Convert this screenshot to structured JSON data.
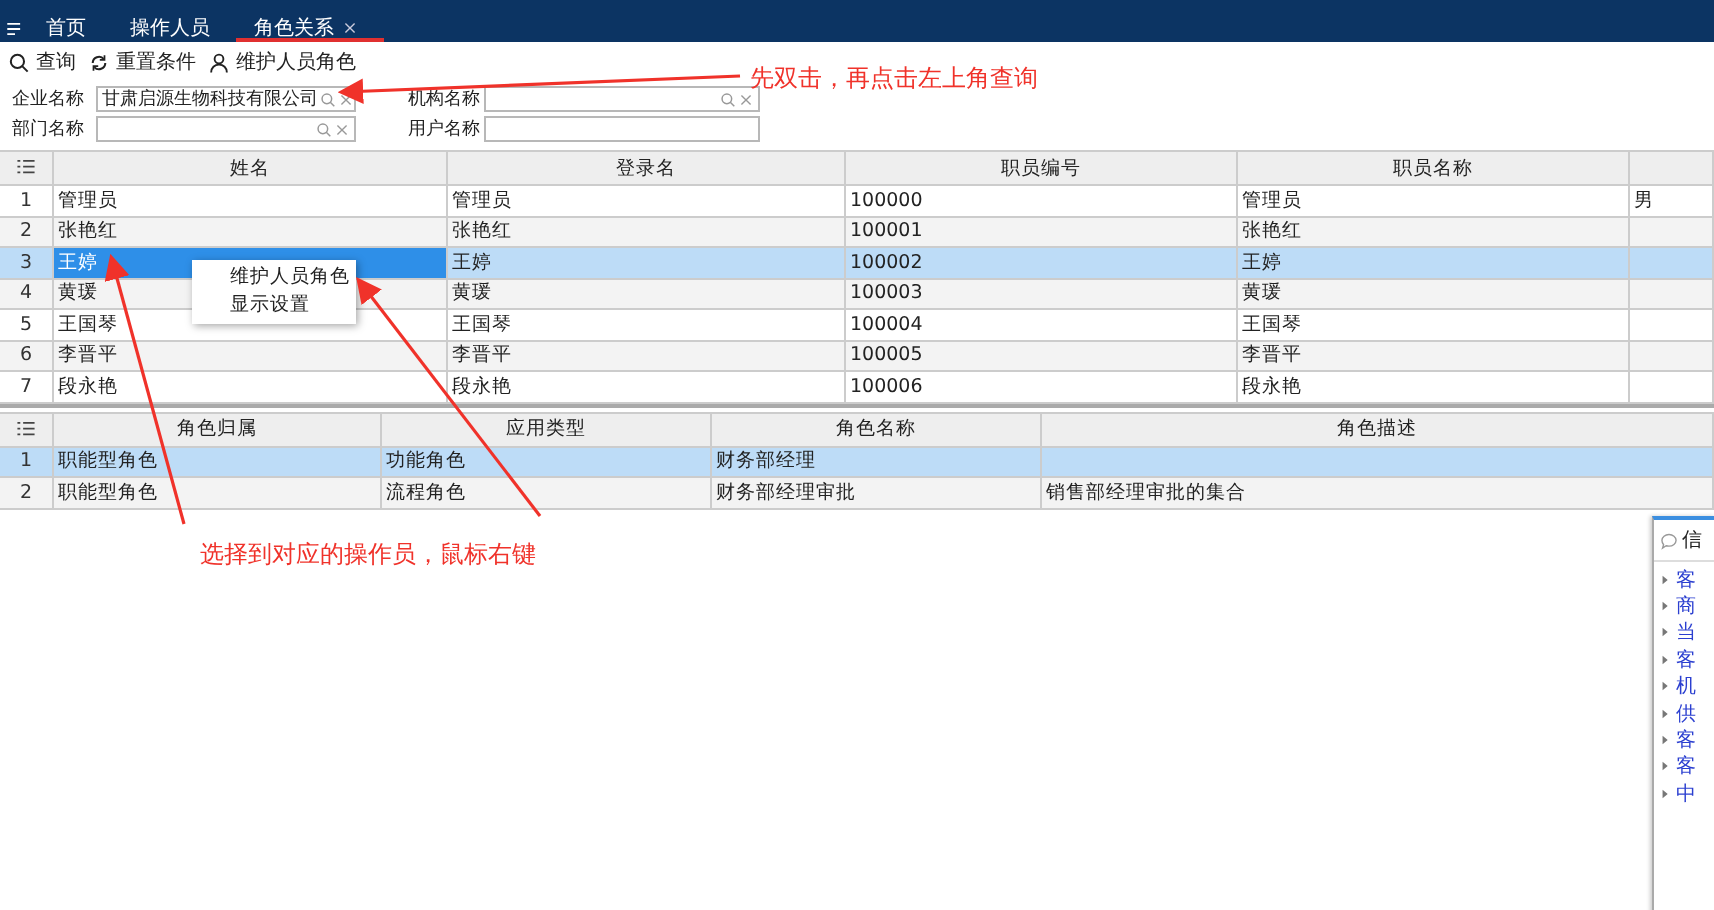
{
  "nav": {
    "tabs": [
      {
        "label": "首页",
        "selected": false,
        "closable": false
      },
      {
        "label": "操作人员",
        "selected": false,
        "closable": false
      },
      {
        "label": "角色关系",
        "selected": true,
        "closable": true
      }
    ]
  },
  "toolbar": {
    "buttons": [
      {
        "label": "查询"
      },
      {
        "label": "重置条件"
      },
      {
        "label": "维护人员角色"
      }
    ]
  },
  "filters": [
    {
      "label": "企业名称",
      "value": "甘肃启源生物科技有限公司",
      "kind": "lookup"
    },
    {
      "label": "机构名称",
      "kind": "lookup"
    },
    {
      "label": "部门名称",
      "kind": "lookup"
    },
    {
      "label": "用户名称",
      "kind": "text"
    }
  ],
  "staff_table": {
    "columns": [
      "姓名",
      "登录名",
      "职员编号",
      "职员名称"
    ],
    "rows": [
      {
        "index": "1",
        "selected": false,
        "cells": [
          "管理员",
          "管理员",
          "100000",
          "管理员",
          "男"
        ]
      },
      {
        "index": "2",
        "selected": false,
        "cells": [
          "张艳红",
          "张艳红",
          "100001",
          "张艳红"
        ]
      },
      {
        "index": "3",
        "selected": true,
        "cells": [
          "王婷",
          "王婷",
          "100002",
          "王婷"
        ]
      },
      {
        "index": "4",
        "selected": false,
        "cells": [
          "黄瑗",
          "黄瑗",
          "100003",
          "黄瑗"
        ]
      },
      {
        "index": "5",
        "selected": false,
        "cells": [
          "王国琴",
          "王国琴",
          "100004",
          "王国琴"
        ]
      },
      {
        "index": "6",
        "selected": false,
        "cells": [
          "李晋平",
          "李晋平",
          "100005",
          "李晋平"
        ]
      },
      {
        "index": "7",
        "selected": false,
        "cells": [
          "段永艳",
          "段永艳",
          "100006",
          "段永艳"
        ]
      }
    ]
  },
  "context_menu": {
    "items": [
      "维护人员角色",
      "显示设置"
    ]
  },
  "role_table": {
    "columns": [
      "角色归属",
      "应用类型",
      "角色名称",
      "角色描述"
    ],
    "rows": [
      {
        "index": "1",
        "selected": true,
        "cells": [
          "职能型角色",
          "功能角色",
          "财务部经理"
        ]
      },
      {
        "index": "2",
        "selected": false,
        "cells": [
          "职能型角色",
          "流程角色",
          "财务部经理审批",
          "销售部经理审批的集合"
        ]
      }
    ]
  },
  "annotations": [
    {
      "text": "先双击，再点击左上角查询"
    },
    {
      "text": "选择到对应的操作员，鼠标右键"
    }
  ],
  "side_panel": {
    "title": "信",
    "items": [
      "客",
      "商",
      "当",
      "客",
      "机",
      "供",
      "客",
      "客",
      "中"
    ]
  }
}
